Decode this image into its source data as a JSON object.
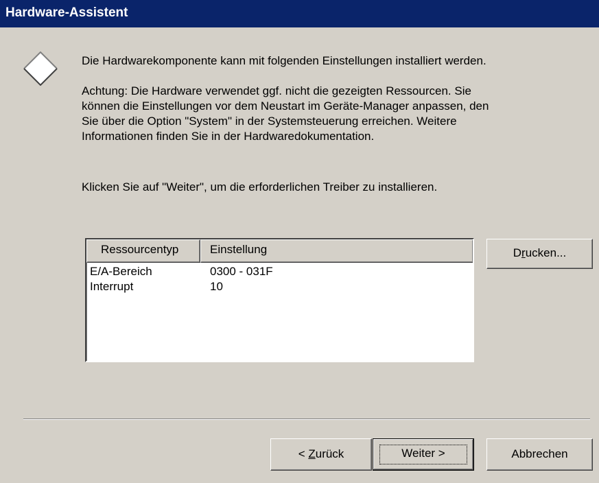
{
  "window": {
    "title": "Hardware-Assistent"
  },
  "content": {
    "icon": "diamond-icon",
    "line1": "Die Hardwarekomponente kann mit folgenden Einstellungen installiert werden.",
    "warning_lines": [
      "Achtung: Die Hardware verwendet ggf. nicht die gezeigten Ressourcen. Sie",
      "können die Einstellungen vor dem Neustart im Geräte-Manager anpassen, den",
      "Sie über die Option \"System\" in der Systemsteuerung erreichen. Weitere",
      "Informationen finden Sie in der Hardwaredokumentation."
    ],
    "instruction": "Klicken Sie auf \"Weiter\", um die erforderlichen Treiber zu installieren."
  },
  "resources": {
    "columns": [
      "Ressourcentyp",
      "Einstellung"
    ],
    "rows": [
      [
        "E/A-Bereich",
        "0300 - 031F"
      ],
      [
        "Interrupt",
        "10"
      ]
    ]
  },
  "buttons": {
    "print": {
      "before": "D",
      "accel": "r",
      "after": "ucken..."
    },
    "back": {
      "before": "< ",
      "accel": "Z",
      "after": "urück"
    },
    "next": "Weiter >",
    "cancel": "Abbrechen"
  }
}
